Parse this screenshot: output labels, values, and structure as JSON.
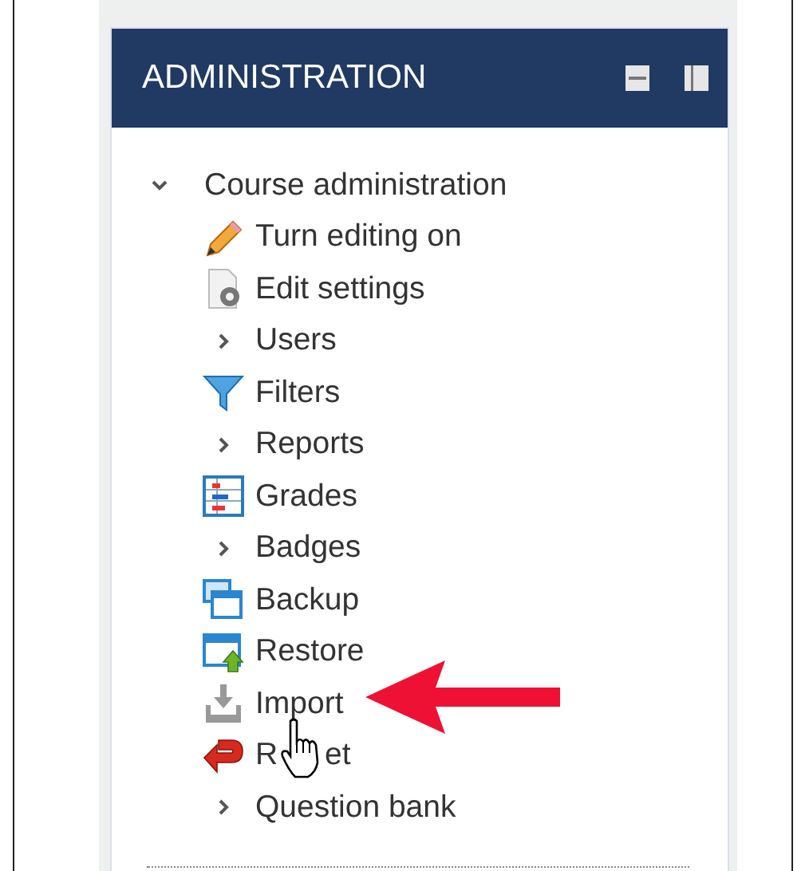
{
  "block": {
    "title": "ADMINISTRATION"
  },
  "tree": [
    {
      "label": "Course administration",
      "kind": "branch",
      "expanded": true,
      "children": [
        {
          "label": "Turn editing on",
          "kind": "link"
        },
        {
          "label": "Edit settings",
          "kind": "link"
        },
        {
          "label": "Users",
          "kind": "branch",
          "expanded": false
        },
        {
          "label": "Filters",
          "kind": "link"
        },
        {
          "label": "Reports",
          "kind": "branch",
          "expanded": false
        },
        {
          "label": "Grades",
          "kind": "link"
        },
        {
          "label": "Badges",
          "kind": "branch",
          "expanded": false
        },
        {
          "label": "Backup",
          "kind": "link"
        },
        {
          "label": "Restore",
          "kind": "link"
        },
        {
          "label": "Import",
          "kind": "link"
        },
        {
          "label": "R et",
          "kind": "link",
          "pointed": true
        },
        {
          "label": "Question bank",
          "kind": "branch",
          "expanded": false
        }
      ]
    }
  ]
}
